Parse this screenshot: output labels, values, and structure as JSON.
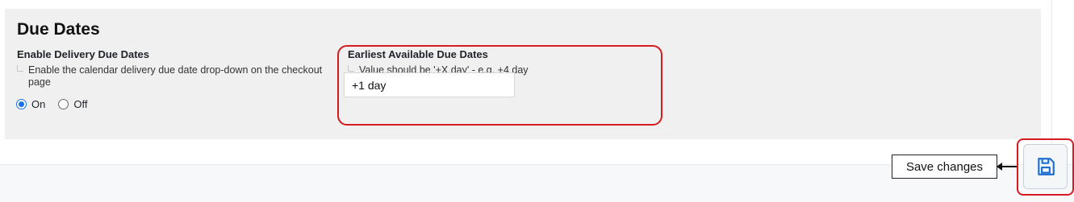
{
  "section": {
    "title": "Due Dates"
  },
  "enable_delivery": {
    "label": "Enable Delivery Due Dates",
    "hint": "Enable the calendar delivery due date drop-down on the checkout page",
    "options": [
      {
        "label": "On",
        "selected": true
      },
      {
        "label": "Off",
        "selected": false
      }
    ]
  },
  "earliest_due": {
    "label": "Earliest Available Due Dates",
    "hint": "Value should be '+X day' - e.g. +4 day",
    "value": "+1 day"
  },
  "save": {
    "tooltip": "Save changes",
    "icon": "floppy-disk-icon"
  },
  "colors": {
    "annotation_red": "#d71920",
    "radio_blue": "#1a73e8",
    "save_icon_blue": "#1f6fd1",
    "panel_bg": "#f0f0f0"
  }
}
